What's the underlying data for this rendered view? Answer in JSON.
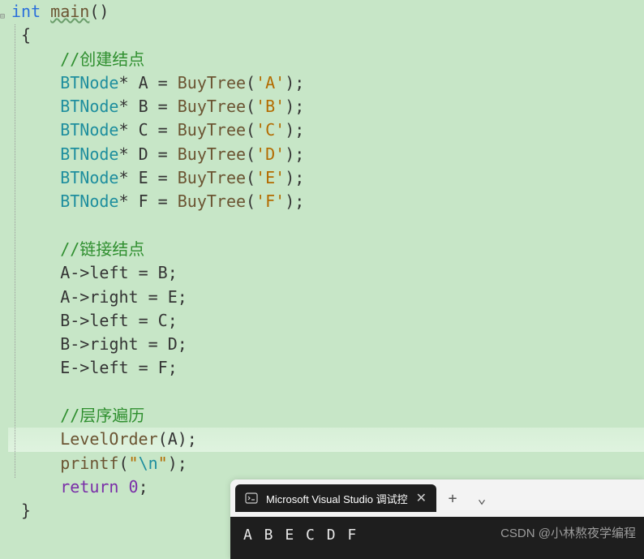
{
  "code": {
    "ret_type": "int",
    "fn_main": "main",
    "open_paren": "(",
    "close_paren": ")",
    "open_brace": "{",
    "close_brace": "}",
    "comment_create": "//创建结点",
    "type_bt": "BTNode",
    "star": "*",
    "eq": "=",
    "fn_buy": "BuyTree",
    "semi": ";",
    "vars": {
      "A": "A",
      "B": "B",
      "C": "C",
      "D": "D",
      "E": "E",
      "F": "F"
    },
    "lits": {
      "A": "'A'",
      "B": "'B'",
      "C": "'C'",
      "D": "'D'",
      "E": "'E'",
      "F": "'F'"
    },
    "comment_link": "//链接结点",
    "arrow": "->",
    "left": "left",
    "right": "right",
    "links": [
      {
        "lhs": "A",
        "field": "left",
        "rhs": "B"
      },
      {
        "lhs": "A",
        "field": "right",
        "rhs": "E"
      },
      {
        "lhs": "B",
        "field": "left",
        "rhs": "C"
      },
      {
        "lhs": "B",
        "field": "right",
        "rhs": "D"
      },
      {
        "lhs": "E",
        "field": "left",
        "rhs": "F"
      }
    ],
    "comment_level": "//层序遍历",
    "fn_level": "LevelOrder",
    "fn_printf": "printf",
    "printf_quote": "\"",
    "printf_esc": "\\n",
    "kw_return": "return",
    "zero": "0"
  },
  "terminal": {
    "tab_title": "Microsoft Visual Studio 调试控",
    "close": "✕",
    "new_tab": "+",
    "dropdown": "⌄",
    "output": "A  B  E  C  D  F"
  },
  "watermark": "CSDN @小林熬夜学编程"
}
